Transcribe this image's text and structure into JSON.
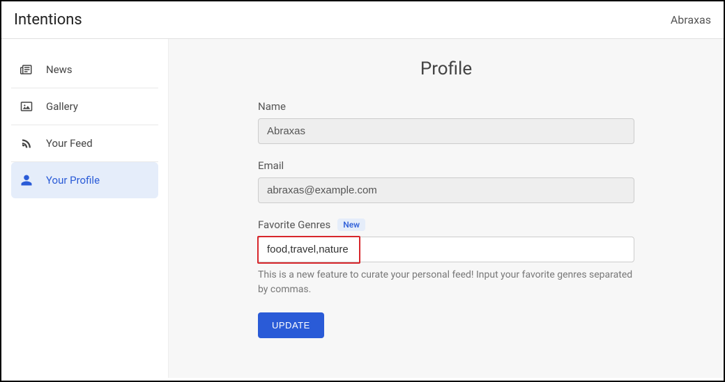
{
  "header": {
    "app_title": "Intentions",
    "username": "Abraxas"
  },
  "sidebar": {
    "items": [
      {
        "label": "News"
      },
      {
        "label": "Gallery"
      },
      {
        "label": "Your Feed"
      },
      {
        "label": "Your Profile"
      }
    ]
  },
  "main": {
    "title": "Profile",
    "name": {
      "label": "Name",
      "value": "Abraxas"
    },
    "email": {
      "label": "Email",
      "value": "abraxas@example.com"
    },
    "genres": {
      "label": "Favorite Genres",
      "badge": "New",
      "value": "food,travel,nature",
      "help": "This is a new feature to curate your personal feed! Input your favorite genres separated by commas."
    },
    "update_label": "UPDATE"
  }
}
